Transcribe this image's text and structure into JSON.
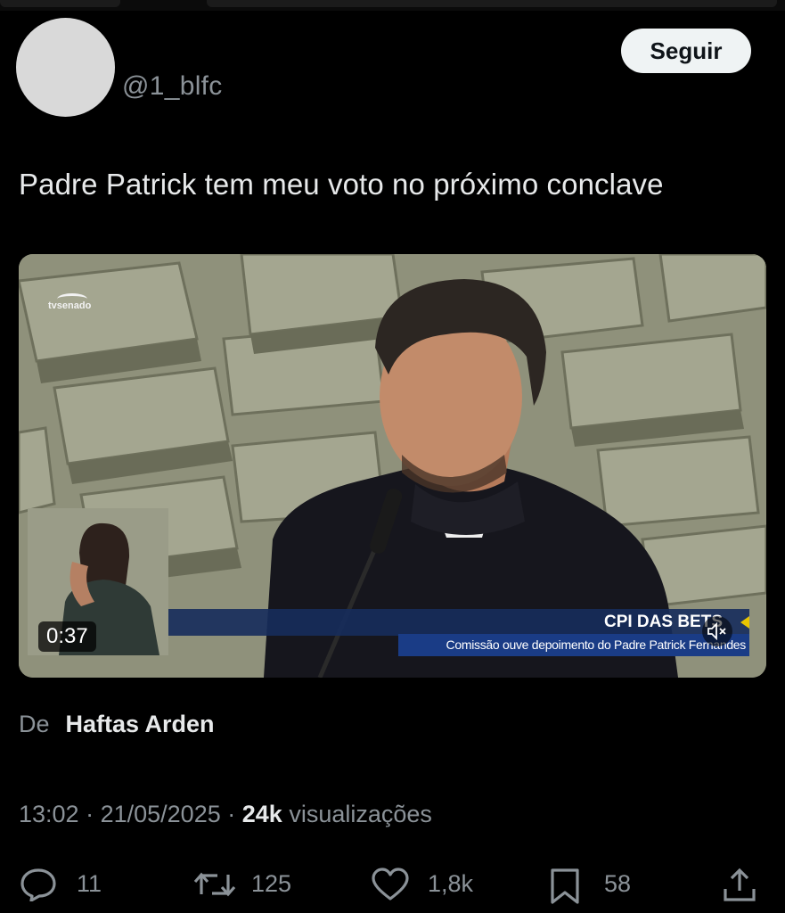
{
  "tweet": {
    "handle": "@1_blfc",
    "follow_label": "Seguir",
    "text": "Padre Patrick tem meu voto no próximo conclave",
    "from_label": "De",
    "from_name": "Haftas Arden",
    "time": "13:02",
    "date": "21/05/2025",
    "views_count": "24k",
    "views_label": "visualizações"
  },
  "video": {
    "channel_logo": "tvsenado",
    "headline": "CPI DAS BETS",
    "subheadline": "Comissão ouve depoimento do Padre Patrick Fernandes",
    "duration": "0:37"
  },
  "actions": {
    "replies": "11",
    "retweets": "125",
    "likes": "1,8k",
    "bookmarks": "58"
  },
  "icons": [
    "reply-icon",
    "retweet-icon",
    "like-icon",
    "bookmark-icon",
    "share-icon",
    "volume-muted-icon"
  ]
}
